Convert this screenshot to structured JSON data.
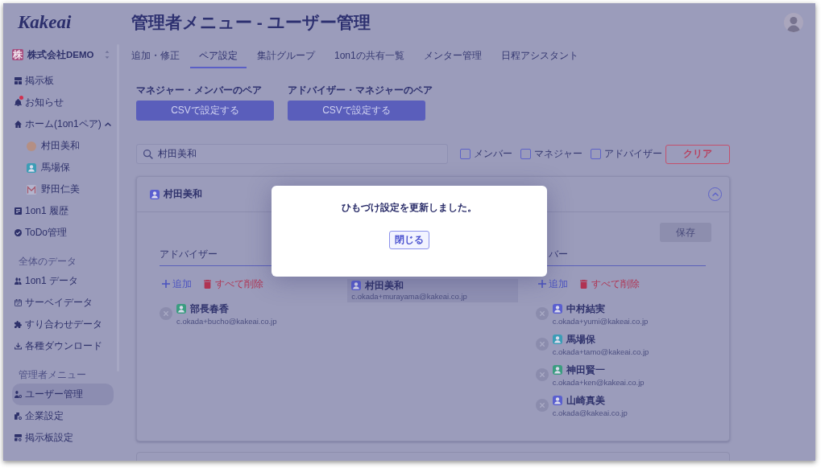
{
  "sidebar": {
    "logo": "Kakeai",
    "company": {
      "badge": "株",
      "name": "株式会社DEMO"
    },
    "sections": [
      {
        "items": [
          {
            "label": "掲示板",
            "selected": false
          },
          {
            "label": "お知らせ",
            "selected": false,
            "unread": true
          },
          {
            "label": "ホーム(1on1ペア)",
            "selected": false,
            "expanded": true,
            "children": [
              {
                "label": "村田美和",
                "selected": false
              },
              {
                "label": "馬場保",
                "selected": false
              },
              {
                "label": "野田仁美",
                "selected": false
              }
            ]
          },
          {
            "label": "1on1 履歴",
            "selected": false
          },
          {
            "label": "ToDo管理",
            "selected": false
          }
        ]
      },
      {
        "label": "全体のデータ",
        "items": [
          {
            "label": "1on1 データ",
            "selected": false
          },
          {
            "label": "サーベイデータ",
            "selected": false
          },
          {
            "label": "すり合わせデータ",
            "selected": false
          },
          {
            "label": "各種ダウンロード",
            "selected": false
          }
        ]
      },
      {
        "label": "管理者メニュー",
        "items": [
          {
            "label": "ユーザー管理",
            "selected": true
          },
          {
            "label": "企業設定",
            "selected": false
          },
          {
            "label": "掲示板設定",
            "selected": false
          }
        ]
      }
    ]
  },
  "header": {
    "title": "管理者メニュー - ユーザー管理"
  },
  "tabs": [
    {
      "label": "追加・修正",
      "selected": false
    },
    {
      "label": "ペア設定",
      "selected": true
    },
    {
      "label": "集計グループ",
      "selected": false
    },
    {
      "label": "1on1の共有一覧",
      "selected": false
    },
    {
      "label": "メンター管理",
      "selected": false
    },
    {
      "label": "日程アシスタント",
      "selected": false
    }
  ],
  "csv_pairs": [
    {
      "label": "マネジャー・メンバーのペア",
      "button": "CSVで設定する"
    },
    {
      "label": "アドバイザー・マネジャーのペア",
      "button": "CSVで設定する"
    }
  ],
  "search": {
    "value": "村田美和"
  },
  "filters": [
    {
      "label": "メンバー",
      "checked": false
    },
    {
      "label": "マネジャー",
      "checked": false
    },
    {
      "label": "アドバイザー",
      "checked": false
    }
  ],
  "clear_button": "クリア",
  "card": {
    "user": {
      "name": "村田美和"
    },
    "expanded": true,
    "save_button": {
      "label": "保存",
      "disabled": true
    },
    "columns": [
      {
        "kind": "editable",
        "heading": "アドバイザー",
        "add": "追加",
        "delete_all": "すべて削除",
        "people": [
          {
            "name": "部長春香",
            "email": "c.okada+bucho@kakeai.co.jp",
            "color": "#3b9d80"
          }
        ]
      },
      {
        "kind": "current",
        "people": [
          {
            "name": "村田美和",
            "email": "c.okada+murayama@kakeai.co.jp",
            "color": "#5a5fcf"
          }
        ]
      },
      {
        "kind": "editable",
        "heading": "バー",
        "add": "追加",
        "delete_all": "すべて削除",
        "people": [
          {
            "name": "中村結実",
            "email": "c.okada+yumi@kakeai.co.jp",
            "color": "#5a5fcf"
          },
          {
            "name": "馬場保",
            "email": "c.okada+tamo@kakeai.co.jp",
            "color": "#3c9db6"
          },
          {
            "name": "神田賢一",
            "email": "c.okada+ken@kakeai.co.jp",
            "color": "#3b9d80"
          },
          {
            "name": "山崎真美",
            "email": "c.okada@kakeai.co.jp",
            "color": "#5a5fcf"
          }
        ]
      }
    ]
  },
  "modal": {
    "message": "ひもづけ設定を更新しました。",
    "button": "閉じる"
  }
}
